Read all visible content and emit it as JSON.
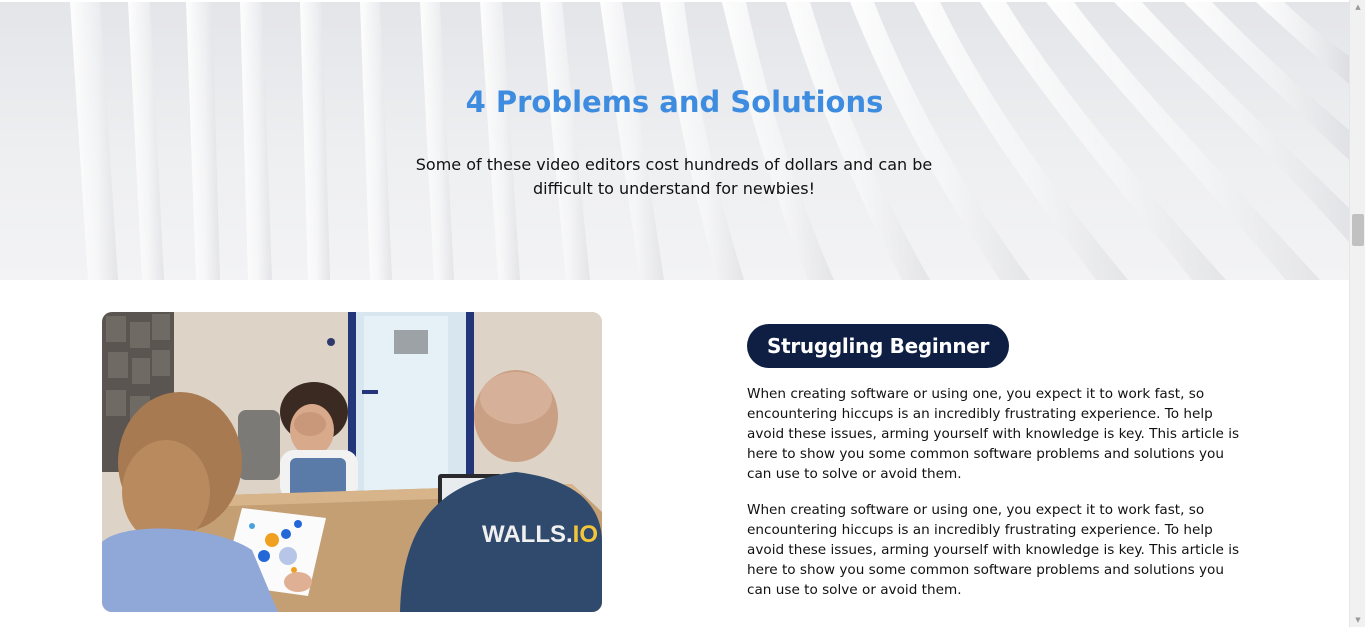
{
  "hero": {
    "title": "4 Problems and Solutions",
    "subtitle": "Some of these video editors cost hundreds of dollars and can be difficult to understand for newbies!",
    "title_color": "#3d8ce0"
  },
  "content": {
    "image_alt": "Three people at a meeting table reviewing a printed chart; one wears a WALLS.IO shirt",
    "shirt_text_main": "WALLS.",
    "shirt_text_accent": "IO",
    "badge_label": "Struggling Beginner",
    "badge_color": "#0f1f44",
    "paragraphs": [
      "When creating software or using one, you expect it to work fast, so encountering hiccups is an incredibly frustrating experience. To help avoid these issues, arming yourself with knowledge is key. This article is here to show you some common software problems and solutions you can use to solve or avoid them.",
      "When creating software or using one, you expect it to work fast, so encountering hiccups is an incredibly frustrating experience. To help avoid these issues, arming yourself with knowledge is key. This article is here to show you some common software problems and solutions you can use to solve or avoid them."
    ]
  },
  "scrollbar": {
    "up_icon": "scroll-up-arrow-icon",
    "down_icon": "scroll-down-arrow-icon"
  }
}
